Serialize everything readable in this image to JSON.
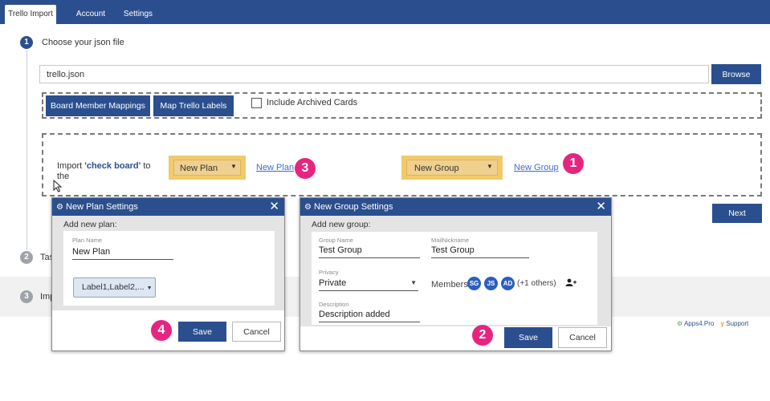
{
  "tabs": [
    "Trello Import",
    "Account",
    "Settings"
  ],
  "steps": {
    "one": {
      "num": "1",
      "label": "Choose your json file"
    },
    "two": {
      "num": "2",
      "label": "Tas"
    },
    "three": {
      "num": "3",
      "label": "Imp"
    }
  },
  "file_input": {
    "value": "trello.json"
  },
  "browse_label": "Browse",
  "board_member_label": "Board Member Mappings",
  "map_labels_label": "Map Trello Labels",
  "archived_label": "Include Archived Cards",
  "import_text": {
    "prefix": "Import ",
    "board": "'check board'",
    "suffix": " to",
    "line2": "the"
  },
  "plan_select": {
    "value": "New Plan"
  },
  "new_plan_link": "New Plan",
  "group_select": {
    "value": "New Group"
  },
  "new_group_link": "New Group",
  "markers": {
    "m1": "1",
    "m2": "2",
    "m3": "3",
    "m4": "4"
  },
  "next_label": "Next",
  "plan_dialog": {
    "title": "New Plan Settings",
    "subtitle": "Add new plan:",
    "name_label": "Plan Name",
    "name_value": "New Plan",
    "labels_value": "Label1,Label2,...",
    "save": "Save",
    "cancel": "Cancel"
  },
  "group_dialog": {
    "title": "New Group Settings",
    "subtitle": "Add new group:",
    "group_name_label": "Group Name",
    "group_name_value": "Test Group",
    "mail_label": "MailNickname",
    "mail_value": "Test Group",
    "privacy_label": "Privacy",
    "privacy_value": "Private",
    "members_label": "Members:",
    "members": [
      "SG",
      "JS",
      "AD"
    ],
    "others": "(+1 others)",
    "desc_label": "Description",
    "desc_value": "Description added",
    "save": "Save",
    "cancel": "Cancel"
  },
  "footer": {
    "apps": "Apps4.Pro",
    "support": "Support"
  },
  "colors": {
    "brand": "#2b4f8e",
    "highlight": "#f2c96b",
    "marker": "#e6257f",
    "link": "#3a6ed3"
  }
}
